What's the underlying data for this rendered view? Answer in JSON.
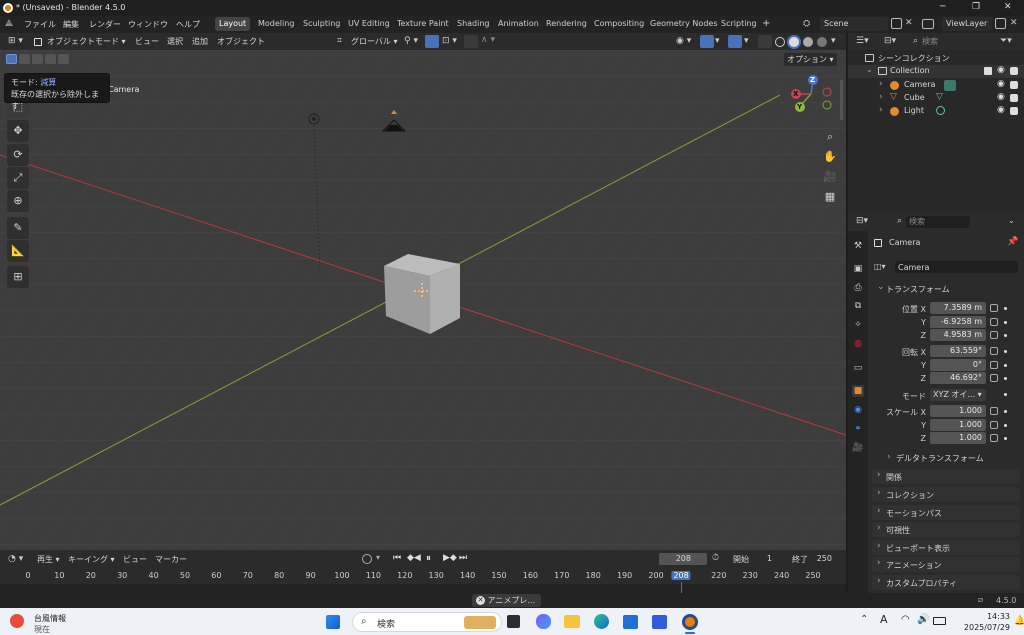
{
  "window": {
    "title": "* (Unsaved) - Blender 4.5.0",
    "controls": [
      "─",
      "❐",
      "✕"
    ]
  },
  "topbar": {
    "menus": [
      "ファイル",
      "編集",
      "レンダー",
      "ウィンドウ",
      "ヘルプ"
    ],
    "workspaces": [
      "Layout",
      "Modeling",
      "Sculpting",
      "UV Editing",
      "Texture Paint",
      "Shading",
      "Animation",
      "Rendering",
      "Compositing",
      "Geometry Nodes",
      "Scripting"
    ],
    "active_workspace": "Layout",
    "add_tab": "+",
    "scene": "Scene",
    "view_layer": "ViewLayer"
  },
  "viewport_header": {
    "mode": "オブジェクトモード",
    "menus": [
      "ビュー",
      "選択",
      "追加",
      "オブジェクト"
    ],
    "transform_orientation": "グローバル",
    "options": "オプション"
  },
  "tooltip": {
    "line1_label": "モード: ",
    "line1_value": "減算",
    "line2": "既存の選択から除外します"
  },
  "viewport": {
    "camera_label": "Camera"
  },
  "gizmo": {
    "x": "X",
    "y": "Y",
    "z": "Z"
  },
  "timeline": {
    "menus": [
      "再生",
      "キーイング",
      "ビュー",
      "マーカー"
    ],
    "current_frame": "208",
    "start_label": "開始",
    "start": "1",
    "end_label": "終了",
    "end": "250",
    "ticks": [
      "0",
      "10",
      "20",
      "30",
      "40",
      "50",
      "60",
      "70",
      "80",
      "90",
      "100",
      "110",
      "120",
      "130",
      "140",
      "150",
      "160",
      "170",
      "180",
      "190",
      "200",
      "208",
      "220",
      "230",
      "240",
      "250"
    ]
  },
  "statusbar": {
    "notice": "アニメプレ...",
    "version": "4.5.0"
  },
  "outliner": {
    "search_placeholder": "検索",
    "root": "シーンコレクション",
    "collection": "Collection",
    "items": [
      "Camera",
      "Cube",
      "Light"
    ]
  },
  "properties": {
    "search_placeholder": "検索",
    "object_name": "Camera",
    "object_field": "Camera",
    "transform_panel": "トランスフォーム",
    "location_label": "位置 X",
    "location": [
      "7.3589 m",
      "-6.9258 m",
      "4.9583 m"
    ],
    "rotation_label": "回転 X",
    "rotation": [
      "63.559°",
      "0°",
      "46.692°"
    ],
    "mode_label": "モード",
    "rotation_mode": "XYZ オイ...",
    "scale_label": "スケール X",
    "scale": [
      "1.000",
      "1.000",
      "1.000"
    ],
    "axis_y": "Y",
    "axis_z": "Z",
    "delta_panel": "デルタトランスフォーム",
    "panels": [
      "関係",
      "コレクション",
      "モーションパス",
      "可視性",
      "ビューポート表示",
      "アニメーション",
      "カスタムプロパティ"
    ]
  },
  "taskbar": {
    "weather_title": "台風情報",
    "weather_sub": "現在",
    "search_placeholder": "検索",
    "ime": "A",
    "time": "14:33",
    "date": "2025/07/29"
  },
  "colors": {
    "accent": "#4a72b8",
    "x_axis": "#b53a44",
    "y_axis": "#7ea33a",
    "object_orange": "#e38a2c",
    "playhead": "#4a72b8"
  }
}
